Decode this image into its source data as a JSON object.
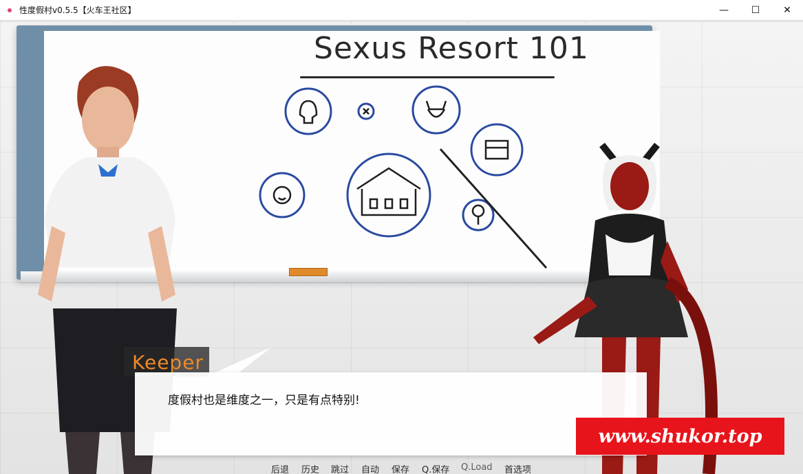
{
  "window": {
    "title": "性度假村v0.5.5【火车王社区】",
    "controls": {
      "minimize": "—",
      "maximize": "☐",
      "close": "✕"
    }
  },
  "scene": {
    "board_title": "Sexus Resort 101"
  },
  "dialogue": {
    "speaker": "Keeper",
    "speaker_color": "#ef8a2a",
    "text": "度假村也是维度之一，只是有点特别!"
  },
  "watermark": {
    "text": "www.shukor.top",
    "color": "#e8141c"
  },
  "quick_menu": [
    "后退",
    "历史",
    "跳过",
    "自动",
    "保存",
    "Q.保存",
    "Q.Load",
    "首选项"
  ]
}
